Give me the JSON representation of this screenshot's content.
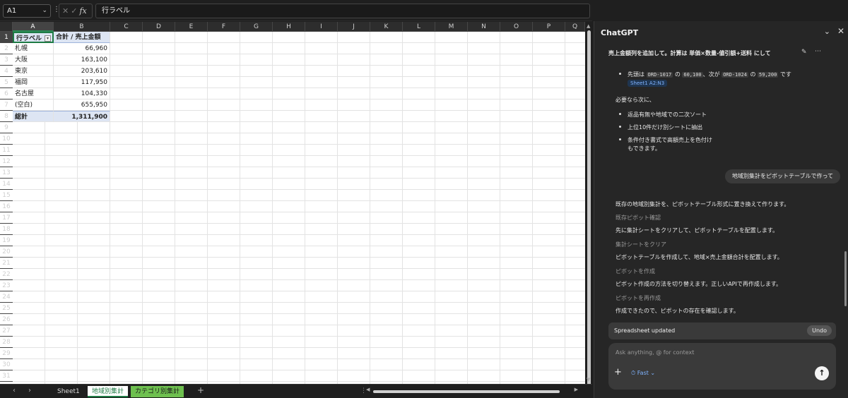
{
  "formula_bar": {
    "name_box": "A1",
    "fx_label": "fx",
    "formula_value": "行ラベル"
  },
  "grid": {
    "columns": [
      "A",
      "B",
      "C",
      "D",
      "E",
      "F",
      "G",
      "H",
      "I",
      "J",
      "K",
      "L",
      "M",
      "N",
      "O",
      "P",
      "Q"
    ],
    "rows": [
      "1",
      "2",
      "3",
      "4",
      "5",
      "6",
      "7",
      "8",
      "9",
      "10",
      "11",
      "12",
      "13",
      "14",
      "15",
      "16",
      "17",
      "18",
      "19",
      "20",
      "21",
      "22",
      "23",
      "24",
      "25",
      "26",
      "27",
      "28",
      "29",
      "30",
      "31"
    ],
    "pivot": {
      "header": [
        "行ラベル",
        "合計 / 売上金額"
      ],
      "data_rows": [
        [
          "札幌",
          "66,960"
        ],
        [
          "大阪",
          "163,100"
        ],
        [
          "東京",
          "203,610"
        ],
        [
          "福岡",
          "117,950"
        ],
        [
          "名古屋",
          "104,330"
        ],
        [
          "(空白)",
          "655,950"
        ]
      ],
      "total_row": [
        "総計",
        "1,311,900"
      ]
    }
  },
  "sheet_tabs": {
    "tabs": [
      "Sheet1",
      "地域別集計",
      "カテゴリ別集計"
    ],
    "active": "地域別集計",
    "add": "+"
  },
  "chat": {
    "title": "ChatGPT",
    "collapse_icon": "chevron-down-icon",
    "close_icon": "close-icon",
    "heading": "売上金額列を追加して。計算は 単価×数量-値引額+送料 にして",
    "bullet1_prefix": "先頭は",
    "bullet1_code1": "ORD-1017",
    "bullet1_mid1": "の",
    "bullet1_code2": "60,100",
    "bullet1_mid2": "、次が",
    "bullet1_code3": "ORD-1024",
    "bullet1_mid3": "の",
    "bullet1_code4": "59,200",
    "bullet1_suffix": "です",
    "ref_chip": "Sheet1 A2:N3",
    "next_label": "必要なら次に、",
    "suggestions": [
      "返品有無や地域での二次ソート",
      "上位10件だけ別シートに抽出",
      "条件付き書式で高額売上を色付け"
    ],
    "suggestion_tail": "もできます。",
    "user_message": "地域別集計をピボットテーブルで作って",
    "response_intro": "既存の地域別集計を、ピボットテーブル形式に置き換えて作ります。",
    "steps": [
      {
        "label": "既存ピボット確認",
        "text": "先に集計シートをクリアして、ピボットテーブルを配置します。"
      },
      {
        "label": "集計シートをクリア",
        "text": "ピボットテーブルを作成して、地域×売上金額合計を配置します。"
      },
      {
        "label": "ピボットを作成",
        "text": "ピボット作成の方法を切り替えます。正しいAPIで再作成します。"
      },
      {
        "label": "ピボットを再作成",
        "text": "作成できたので、ピボットの存在を確認します。"
      }
    ],
    "updated_text": "Spreadsheet updated",
    "undo_label": "Undo",
    "composer_placeholder": "Ask anything, @ for context",
    "model_label": "Fast"
  }
}
